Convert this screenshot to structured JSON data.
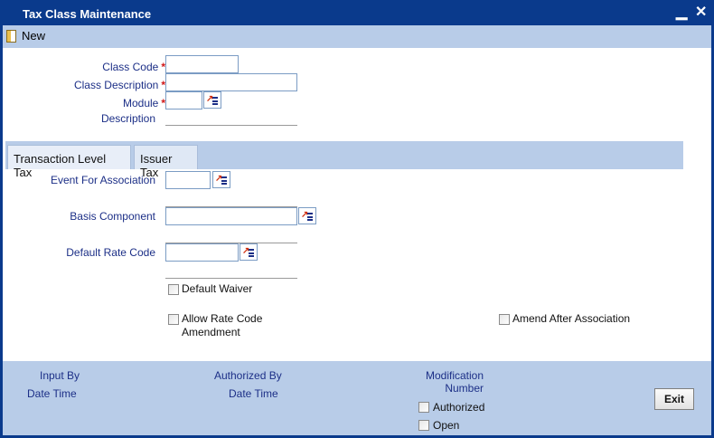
{
  "window": {
    "title": "Tax Class Maintenance",
    "minimize_glyph": "▁",
    "close_glyph": "✕"
  },
  "toolbar": {
    "new_label": "New"
  },
  "form": {
    "class_code_label": "Class Code",
    "class_code_value": "",
    "class_description_label": "Class Description",
    "class_description_value": "",
    "module_label": "Module",
    "module_value": "",
    "description_label": "Description",
    "required_marker": "*"
  },
  "tabs": [
    {
      "label": "Transaction Level Tax",
      "active": true
    },
    {
      "label": "Issuer Tax",
      "active": false
    }
  ],
  "tab_content": {
    "event_label": "Event For Association",
    "event_value": "",
    "basis_label": "Basis Component",
    "basis_value": "",
    "rate_label": "Default Rate Code",
    "rate_value": "",
    "default_waiver_label": "Default Waiver",
    "default_waiver_checked": false,
    "allow_rate_line1": "Allow Rate Code",
    "allow_rate_line2": "Amendment",
    "allow_rate_checked": false,
    "amend_after_label": "Amend After Association",
    "amend_after_checked": false
  },
  "footer": {
    "input_by_label": "Input By",
    "date_time_label_1": "Date Time",
    "authorized_by_label": "Authorized By",
    "date_time_label_2": "Date Time",
    "modification_line1": "Modification",
    "modification_line2": "Number",
    "authorized_label": "Authorized",
    "open_label": "Open",
    "exit_label": "Exit"
  },
  "colors": {
    "titlebar": "#0a3a8c",
    "band": "#b8cce8",
    "label": "#1c2f87",
    "required": "#d01818"
  },
  "icons": [
    "doc-new-icon",
    "lov-icon",
    "minimize-icon",
    "close-icon"
  ]
}
